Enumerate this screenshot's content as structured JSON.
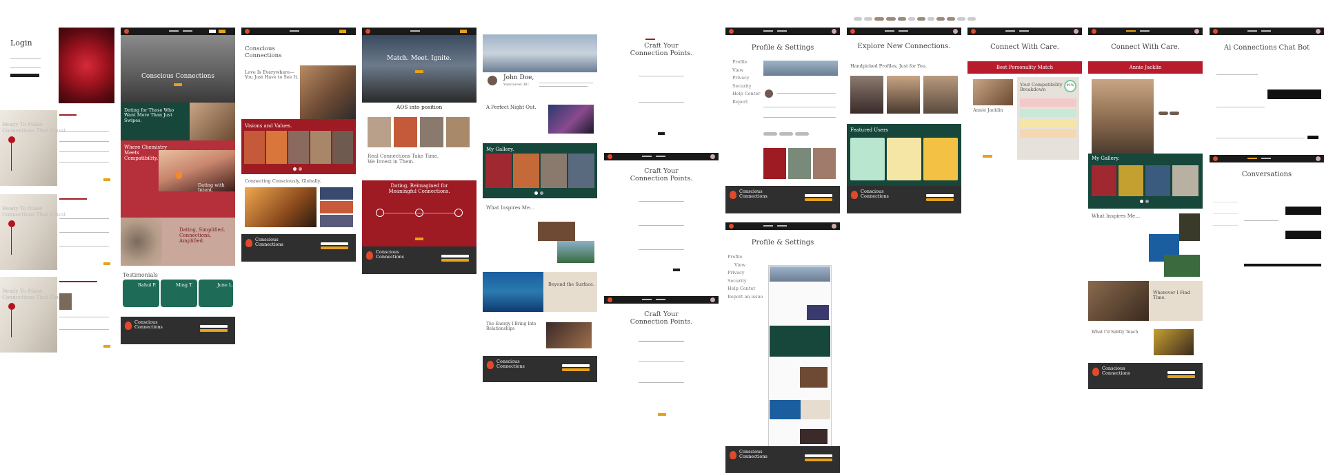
{
  "colors": {
    "brand_red": "#9e1b24",
    "brand_green": "#17463a",
    "gold": "#e8a21a",
    "dark": "#1e1e1e",
    "footer": "#2f2f2f",
    "cream": "#e7ddcf"
  },
  "brand": {
    "name_line1": "Conscious",
    "name_line2": "Connections",
    "logo_icon": "flame-heart-icon"
  },
  "login": {
    "title": "Login"
  },
  "signup": {
    "heading_line1": "Ready To Make",
    "heading_line2": "Connections That Count"
  },
  "landing": {
    "hero_title": "Conscious Connections",
    "section1": "Dating for Those Who Want More Than Just Swipes.",
    "section2": "Where Chemistry Meets Compatibility.",
    "section3": "Dating with Intent.",
    "section4": "Dating, Simplified. Connections, Amplified.",
    "testimonials_label": "Testimonials",
    "testimonials": [
      {
        "name": "Rahul P."
      },
      {
        "name": "Ming T."
      },
      {
        "name": "June L."
      }
    ]
  },
  "about": {
    "title_line1": "Conscious",
    "title_line2": "Connections",
    "love_line1": "Love Is Everywhere—",
    "love_line2": "You Just Have to See It.",
    "visions": "Visions and Values.",
    "globally": "Connecting Consciously, Globally."
  },
  "events": {
    "hero": "Match. Meet. Ignite.",
    "aos": "AOS into position",
    "real_line1": "Real Connections Take Time,",
    "real_line2": "We Invest in Them.",
    "dating_line1": "Dating, Reimagined for",
    "dating_line2": "Meaningful Connections."
  },
  "profile": {
    "name": "John Doe,",
    "location": "Vancouver, BC",
    "perfect_night": "A Perfect Night Out.",
    "gallery": "My Gallery.",
    "inspires": "What Inspires Me…",
    "beyond": "Beyond the Surface.",
    "energy_line1": "The Energy I Bring Into",
    "energy_line2": "Relationships"
  },
  "craft": {
    "title_line1": "Craft Your",
    "title_line2": "Connection Points."
  },
  "settings": {
    "title": "Profile & Settings",
    "menu": [
      "Profile",
      "View",
      "Privacy",
      "Security",
      "Help Center",
      "Report"
    ],
    "menu2": [
      "Profile",
      "View",
      "Privacy",
      "Security",
      "Help Center",
      "Report an issue"
    ]
  },
  "explore": {
    "title": "Explore New Connections.",
    "handpicked": "Handpicked Profiles, Just for You.",
    "featured": "Featured Users"
  },
  "care": {
    "title": "Connect With Care.",
    "match": "Best Personality Match",
    "compat_line1": "Your Compatibility",
    "compat_line2": "Breakdown",
    "person": "Annie Jacklin",
    "percent": "91%"
  },
  "care2": {
    "title": "Connect With Care.",
    "person": "Annie Jacklin",
    "gallery": "My Gallery.",
    "inspires": "What Inspires Me…",
    "wherever": "Wherever I Find Time.",
    "lessons": "What I’d Subtly Teach"
  },
  "chat": {
    "title": "Ai Connections Chat Bot",
    "conversations": "Conversations"
  }
}
